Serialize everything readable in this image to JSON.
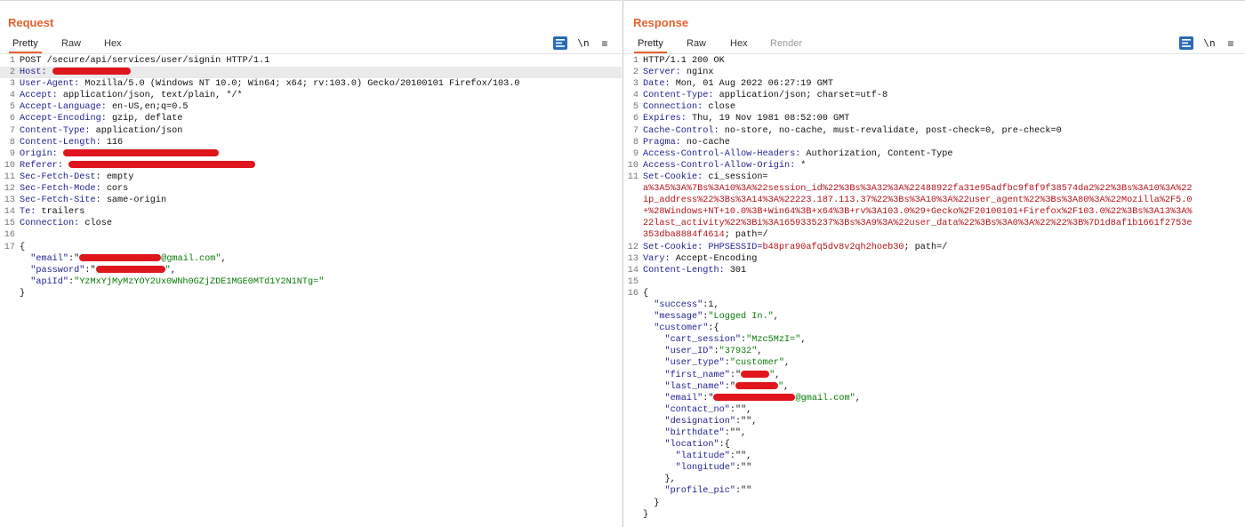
{
  "request": {
    "title": "Request",
    "tabs": [
      "Pretty",
      "Raw",
      "Hex"
    ],
    "icons": {
      "format": "wrap-format-icon",
      "newline": "\\n",
      "menu": "≡"
    }
  },
  "response": {
    "title": "Response",
    "tabs": [
      "Pretty",
      "Raw",
      "Hex",
      "Render"
    ],
    "icons": {
      "format": "wrap-format-icon",
      "newline": "\\n",
      "menu": "≡"
    }
  },
  "layout_toggle": {
    "options": [
      "side-by-side",
      "horizontal",
      "vertical"
    ],
    "selected": "side-by-side"
  },
  "req_lines": [
    {
      "n": "1",
      "segs": [
        {
          "c": "POST /secure/api/services/user/signin HTTP/1.1",
          "t": "plain"
        }
      ]
    },
    {
      "n": "2",
      "segs": [
        {
          "c": "Host:",
          "t": "key"
        },
        {
          "c": " ",
          "t": "plain"
        },
        {
          "redact": 88
        }
      ],
      "hl": true
    },
    {
      "n": "3",
      "segs": [
        {
          "c": "User-Agent:",
          "t": "key"
        },
        {
          "c": " Mozilla/5.0 (Windows NT 10.0; Win64; x64; rv:103.0) Gecko/20100101 Firefox/103.0",
          "t": "plain"
        }
      ]
    },
    {
      "n": "4",
      "segs": [
        {
          "c": "Accept:",
          "t": "key"
        },
        {
          "c": " application/json, text/plain, */*",
          "t": "plain"
        }
      ]
    },
    {
      "n": "5",
      "segs": [
        {
          "c": "Accept-Language:",
          "t": "key"
        },
        {
          "c": " en-US,en;q=0.5",
          "t": "plain"
        }
      ]
    },
    {
      "n": "6",
      "segs": [
        {
          "c": "Accept-Encoding:",
          "t": "key"
        },
        {
          "c": " gzip, deflate",
          "t": "plain"
        }
      ]
    },
    {
      "n": "7",
      "segs": [
        {
          "c": "Content-Type:",
          "t": "key"
        },
        {
          "c": " application/json",
          "t": "plain"
        }
      ]
    },
    {
      "n": "8",
      "segs": [
        {
          "c": "Content-Length:",
          "t": "key"
        },
        {
          "c": " 116",
          "t": "plain"
        }
      ]
    },
    {
      "n": "9",
      "segs": [
        {
          "c": "Origin:",
          "t": "key"
        },
        {
          "c": " ",
          "t": "plain"
        },
        {
          "redact": 175
        }
      ]
    },
    {
      "n": "10",
      "segs": [
        {
          "c": "Referer:",
          "t": "key"
        },
        {
          "c": " ",
          "t": "plain"
        },
        {
          "redact": 210
        }
      ]
    },
    {
      "n": "11",
      "segs": [
        {
          "c": "Sec-Fetch-Dest:",
          "t": "key"
        },
        {
          "c": " empty",
          "t": "plain"
        }
      ]
    },
    {
      "n": "12",
      "segs": [
        {
          "c": "Sec-Fetch-Mode:",
          "t": "key"
        },
        {
          "c": " cors",
          "t": "plain"
        }
      ]
    },
    {
      "n": "13",
      "segs": [
        {
          "c": "Sec-Fetch-Site:",
          "t": "key"
        },
        {
          "c": " same-origin",
          "t": "plain"
        }
      ]
    },
    {
      "n": "14",
      "segs": [
        {
          "c": "Te:",
          "t": "key"
        },
        {
          "c": " trailers",
          "t": "plain"
        }
      ]
    },
    {
      "n": "15",
      "segs": [
        {
          "c": "Connection:",
          "t": "key"
        },
        {
          "c": " close",
          "t": "plain"
        }
      ]
    },
    {
      "n": "16",
      "segs": []
    },
    {
      "n": "17",
      "segs": [
        {
          "c": "{",
          "t": "plain"
        }
      ]
    },
    {
      "n": "",
      "segs": [
        {
          "c": "  \"email\"",
          "t": "key"
        },
        {
          "c": ":\"",
          "t": "plain"
        },
        {
          "redact": 92
        },
        {
          "c": "@gmail.com\"",
          "t": "str"
        },
        {
          "c": ",",
          "t": "plain"
        }
      ]
    },
    {
      "n": "",
      "segs": [
        {
          "c": "  \"password\"",
          "t": "key"
        },
        {
          "c": ":\"",
          "t": "plain"
        },
        {
          "redact": 78
        },
        {
          "c": "\"",
          "t": "str"
        },
        {
          "c": ",",
          "t": "plain"
        }
      ]
    },
    {
      "n": "",
      "segs": [
        {
          "c": "  \"apiId\"",
          "t": "key"
        },
        {
          "c": ":",
          "t": "plain"
        },
        {
          "c": "\"YzMxYjMyMzYOY2Ux0WNh0GZjZDE1MGE0MTd1Y2N1NTg=\"",
          "t": "str"
        }
      ]
    },
    {
      "n": "",
      "segs": [
        {
          "c": "}",
          "t": "plain"
        }
      ]
    }
  ],
  "resp_lines": [
    {
      "n": "1",
      "segs": [
        {
          "c": "HTTP/1.1 200 OK",
          "t": "plain"
        }
      ]
    },
    {
      "n": "2",
      "segs": [
        {
          "c": "Server:",
          "t": "key"
        },
        {
          "c": " nginx",
          "t": "plain"
        }
      ]
    },
    {
      "n": "3",
      "segs": [
        {
          "c": "Date:",
          "t": "key"
        },
        {
          "c": " Mon, 01 Aug 2022 06:27:19 GMT",
          "t": "plain"
        }
      ]
    },
    {
      "n": "4",
      "segs": [
        {
          "c": "Content-Type:",
          "t": "key"
        },
        {
          "c": " application/json; charset=utf-8",
          "t": "plain"
        }
      ]
    },
    {
      "n": "5",
      "segs": [
        {
          "c": "Connection:",
          "t": "key"
        },
        {
          "c": " close",
          "t": "plain"
        }
      ]
    },
    {
      "n": "6",
      "segs": [
        {
          "c": "Expires:",
          "t": "key"
        },
        {
          "c": " Thu, 19 Nov 1981 08:52:00 GMT",
          "t": "plain"
        }
      ]
    },
    {
      "n": "7",
      "segs": [
        {
          "c": "Cache-Control:",
          "t": "key"
        },
        {
          "c": " no-store, no-cache, must-revalidate, post-check=0, pre-check=0",
          "t": "plain"
        }
      ]
    },
    {
      "n": "8",
      "segs": [
        {
          "c": "Pragma:",
          "t": "key"
        },
        {
          "c": " no-cache",
          "t": "plain"
        }
      ]
    },
    {
      "n": "9",
      "segs": [
        {
          "c": "Access-Control-Allow-Headers:",
          "t": "key"
        },
        {
          "c": " Authorization, Content-Type",
          "t": "plain"
        }
      ]
    },
    {
      "n": "10",
      "segs": [
        {
          "c": "Access-Control-Allow-Origin:",
          "t": "key"
        },
        {
          "c": " *",
          "t": "plain"
        }
      ]
    },
    {
      "n": "11",
      "segs": [
        {
          "c": "Set-Cookie:",
          "t": "key"
        },
        {
          "c": " ci_session=",
          "t": "plain"
        }
      ]
    },
    {
      "n": "",
      "segs": [
        {
          "c": "a%3A5%3A%7Bs%3A10%3A%22session_id%22%3Bs%3A32%3A%22488922fa31e95adfbc9f8f9f38574da2%22%3Bs%3A10%3A%22",
          "t": "cookie"
        }
      ]
    },
    {
      "n": "",
      "segs": [
        {
          "c": "ip_address%22%3Bs%3A14%3A%22223.187.113.37%22%3Bs%3A10%3A%22user_agent%22%3Bs%3A80%3A%22Mozilla%2F5.0",
          "t": "cookie"
        }
      ]
    },
    {
      "n": "",
      "segs": [
        {
          "c": "+%28Windows+NT+10.0%3B+Win64%3B+x64%3B+rv%3A103.0%29+Gecko%2F20100101+Firefox%2F103.0%22%3Bs%3A13%3A%",
          "t": "cookie"
        }
      ]
    },
    {
      "n": "",
      "segs": [
        {
          "c": "22last_activity%22%3Bi%3A1659335237%3Bs%3A9%3A%22user_data%22%3Bs%3A0%3A%22%22%3B%7D1d8af1b1661f2753e",
          "t": "cookie"
        }
      ]
    },
    {
      "n": "",
      "segs": [
        {
          "c": "353dba8884f4614",
          "t": "cookie"
        },
        {
          "c": "; path=/",
          "t": "plain"
        }
      ]
    },
    {
      "n": "12",
      "segs": [
        {
          "c": "Set-Cookie:",
          "t": "key"
        },
        {
          "c": " PHPSESSID=",
          "t": "key"
        },
        {
          "c": "b48pra90afq5dv8v2qh2hoeb30",
          "t": "cookie"
        },
        {
          "c": "; path=/",
          "t": "plain"
        }
      ]
    },
    {
      "n": "13",
      "segs": [
        {
          "c": "Vary:",
          "t": "key"
        },
        {
          "c": " Accept-Encoding",
          "t": "plain"
        }
      ]
    },
    {
      "n": "14",
      "segs": [
        {
          "c": "Content-Length:",
          "t": "key"
        },
        {
          "c": " 301",
          "t": "plain"
        }
      ]
    },
    {
      "n": "15",
      "segs": []
    },
    {
      "n": "16",
      "segs": [
        {
          "c": "{",
          "t": "plain"
        }
      ]
    },
    {
      "n": "",
      "segs": [
        {
          "c": "  \"success\"",
          "t": "key"
        },
        {
          "c": ":1,",
          "t": "plain"
        }
      ]
    },
    {
      "n": "",
      "segs": [
        {
          "c": "  \"message\"",
          "t": "key"
        },
        {
          "c": ":",
          "t": "plain"
        },
        {
          "c": "\"Logged In.\"",
          "t": "str"
        },
        {
          "c": ",",
          "t": "plain"
        }
      ]
    },
    {
      "n": "",
      "segs": [
        {
          "c": "  \"customer\"",
          "t": "key"
        },
        {
          "c": ":{",
          "t": "plain"
        }
      ]
    },
    {
      "n": "",
      "segs": [
        {
          "c": "    \"cart_session\"",
          "t": "key"
        },
        {
          "c": ":",
          "t": "plain"
        },
        {
          "c": "\"Mzc5MzI=\"",
          "t": "str"
        },
        {
          "c": ",",
          "t": "plain"
        }
      ]
    },
    {
      "n": "",
      "segs": [
        {
          "c": "    \"user_ID\"",
          "t": "key"
        },
        {
          "c": ":",
          "t": "plain"
        },
        {
          "c": "\"37932\"",
          "t": "str"
        },
        {
          "c": ",",
          "t": "plain"
        }
      ]
    },
    {
      "n": "",
      "segs": [
        {
          "c": "    \"user_type\"",
          "t": "key"
        },
        {
          "c": ":",
          "t": "plain"
        },
        {
          "c": "\"customer\"",
          "t": "str"
        },
        {
          "c": ",",
          "t": "plain"
        }
      ]
    },
    {
      "n": "",
      "segs": [
        {
          "c": "    \"first_name\"",
          "t": "key"
        },
        {
          "c": ":\"",
          "t": "plain"
        },
        {
          "redact": 32
        },
        {
          "c": "\"",
          "t": "str"
        },
        {
          "c": ",",
          "t": "plain"
        }
      ]
    },
    {
      "n": "",
      "segs": [
        {
          "c": "    \"last_name\"",
          "t": "key"
        },
        {
          "c": ":\"",
          "t": "plain"
        },
        {
          "redact": 48
        },
        {
          "c": "\"",
          "t": "str"
        },
        {
          "c": ",",
          "t": "plain"
        }
      ]
    },
    {
      "n": "",
      "segs": [
        {
          "c": "    \"email\"",
          "t": "key"
        },
        {
          "c": ":\"",
          "t": "plain"
        },
        {
          "redact": 92
        },
        {
          "c": "@gmail.com\"",
          "t": "str"
        },
        {
          "c": ",",
          "t": "plain"
        }
      ]
    },
    {
      "n": "",
      "segs": [
        {
          "c": "    \"contact_no\"",
          "t": "key"
        },
        {
          "c": ":\"\",",
          "t": "plain"
        }
      ]
    },
    {
      "n": "",
      "segs": [
        {
          "c": "    \"designation\"",
          "t": "key"
        },
        {
          "c": ":\"\",",
          "t": "plain"
        }
      ]
    },
    {
      "n": "",
      "segs": [
        {
          "c": "    \"birthdate\"",
          "t": "key"
        },
        {
          "c": ":\"\",",
          "t": "plain"
        }
      ]
    },
    {
      "n": "",
      "segs": [
        {
          "c": "    \"location\"",
          "t": "key"
        },
        {
          "c": ":{",
          "t": "plain"
        }
      ]
    },
    {
      "n": "",
      "segs": [
        {
          "c": "      \"latitude\"",
          "t": "key"
        },
        {
          "c": ":\"\",",
          "t": "plain"
        }
      ]
    },
    {
      "n": "",
      "segs": [
        {
          "c": "      \"longitude\"",
          "t": "key"
        },
        {
          "c": ":\"\"",
          "t": "plain"
        }
      ]
    },
    {
      "n": "",
      "segs": [
        {
          "c": "    },",
          "t": "plain"
        }
      ]
    },
    {
      "n": "",
      "segs": [
        {
          "c": "    \"profile_pic\"",
          "t": "key"
        },
        {
          "c": ":\"\"",
          "t": "plain"
        }
      ]
    },
    {
      "n": "",
      "segs": [
        {
          "c": "  }",
          "t": "plain"
        }
      ]
    },
    {
      "n": "",
      "segs": [
        {
          "c": "}",
          "t": "plain"
        }
      ]
    }
  ]
}
